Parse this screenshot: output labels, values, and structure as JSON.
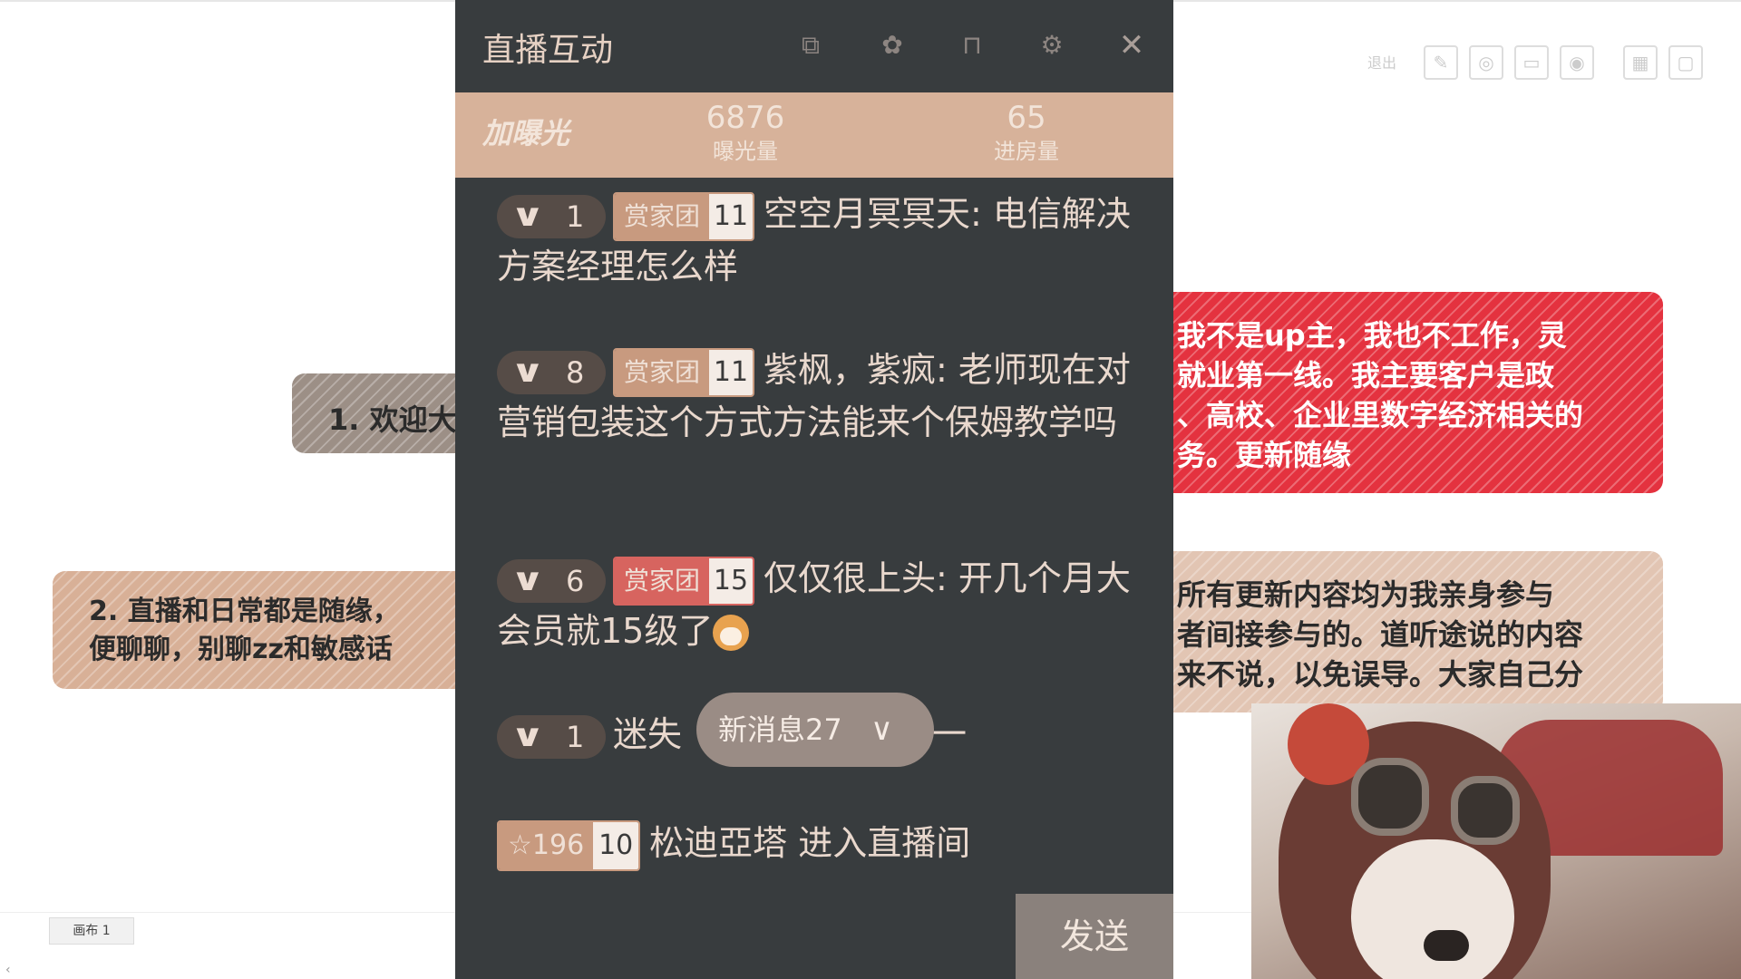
{
  "canvas": {
    "card_gray": "1. 欢迎大",
    "card_tan": "2. 直播和日常都是随缘，\n便聊聊，别聊zz和敏感话",
    "card_red": "我不是up主，我也不工作，灵\n就业第一线。我主要客户是政\n、高校、企业里数字经济相关的\n务。更新随缘",
    "card_beige": "所有更新内容均为我亲身参与\n者间接参与的。道听途说的内容\n来不说，以免误导。大家自己分",
    "toolbar_exit": "退出",
    "canvas_tab": "画布 1",
    "corner_arrow": "‹"
  },
  "panel": {
    "title": "直播互动",
    "header_icons": [
      "screen-share-icon",
      "puzzle-icon",
      "lock-icon",
      "gear-icon",
      "close-icon"
    ],
    "boost_label": "加曝光",
    "stats": [
      {
        "value": "6876",
        "label": "曝光量"
      },
      {
        "value": "65",
        "label": "进房量"
      }
    ],
    "messages": [
      {
        "level": "1",
        "badge": "赏家团",
        "badge_level": "11",
        "text": "空空月冥冥天: 电信解决方案经理怎么样"
      },
      {
        "level": "8",
        "badge": "赏家团",
        "badge_level": "11",
        "text": "紫枫，紫疯: 老师现在对营销包装这个方式方法能来个保姆教学吗"
      },
      {
        "level": "6",
        "badge": "赏家团",
        "badge_level": "15",
        "text": "仅仅很上头: 开几个月大会员就15级了"
      },
      {
        "level": "1",
        "text_left": "迷失",
        "text_right": "习加一"
      }
    ],
    "entry": {
      "star": "☆196",
      "level": "10",
      "text": "松迪亞塔 进入直播间"
    },
    "new_msg": "新消息27",
    "send": "发送",
    "colors": {
      "panel_bg": "#383c3e",
      "stats_bg": "#d7b29a",
      "badge_tan": "#c89a7f",
      "badge_red": "#d7645f"
    }
  }
}
